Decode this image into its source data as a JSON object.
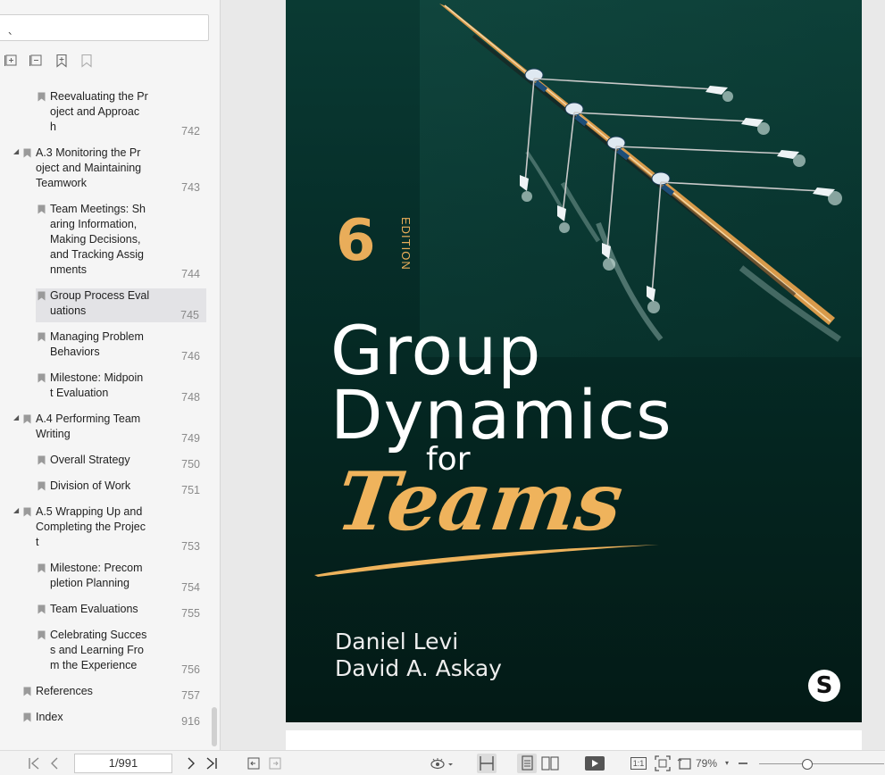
{
  "sidebar": {
    "search_value": "、",
    "tools": [
      "expand-all-icon",
      "collapse-all-icon",
      "add-bookmark-icon",
      "bookmark-outline-icon"
    ],
    "outline": [
      {
        "label": "Reevaluating the Pr\noject and Approac\nh",
        "page": "742",
        "level": 2
      },
      {
        "label": "A.3 Monitoring the Pr\noject and Maintaining\nTeamwork",
        "page": "743",
        "level": 1,
        "expanded": true
      },
      {
        "label": "Team Meetings: Sh\naring Information,\nMaking Decisions,\nand Tracking Assig\nnments",
        "page": "744",
        "level": 2
      },
      {
        "label": "Group Process Eval\nuations",
        "page": "745",
        "level": 2,
        "selected": true
      },
      {
        "label": "Managing Problem\nBehaviors",
        "page": "746",
        "level": 2
      },
      {
        "label": "Milestone: Midpoin\nt Evaluation",
        "page": "748",
        "level": 2
      },
      {
        "label": "A.4 Performing Team\nWriting",
        "page": "749",
        "level": 1,
        "expanded": true
      },
      {
        "label": "Overall Strategy",
        "page": "750",
        "level": 2
      },
      {
        "label": "Division of Work",
        "page": "751",
        "level": 2
      },
      {
        "label": "A.5 Wrapping Up and\nCompleting the Projec\nt",
        "page": "753",
        "level": 1,
        "expanded": true
      },
      {
        "label": "Milestone: Precom\npletion Planning",
        "page": "754",
        "level": 2
      },
      {
        "label": "Team Evaluations",
        "page": "755",
        "level": 2
      },
      {
        "label": "Celebrating Succes\ns and Learning Fro\nm the Experience",
        "page": "756",
        "level": 2
      },
      {
        "label": "References",
        "page": "757",
        "level": 0
      },
      {
        "label": "Index",
        "page": "916",
        "level": 0
      }
    ]
  },
  "cover": {
    "edition_number": "6",
    "edition_label": "EDITION",
    "title_line1": "Group",
    "title_line2": "Dynamics",
    "title_for": "for",
    "title_teams": "Teams",
    "author1": "Daniel Levi",
    "author2": "David A. Askay",
    "publisher_logo": "S",
    "colors": {
      "background": "#04241f",
      "accent": "#e9ad5a",
      "title": "#ffffff"
    }
  },
  "statusbar": {
    "page_indicator": "1/991",
    "zoom": "79%",
    "zoom_level_percent": 79,
    "actual_size_label": "1:1"
  }
}
